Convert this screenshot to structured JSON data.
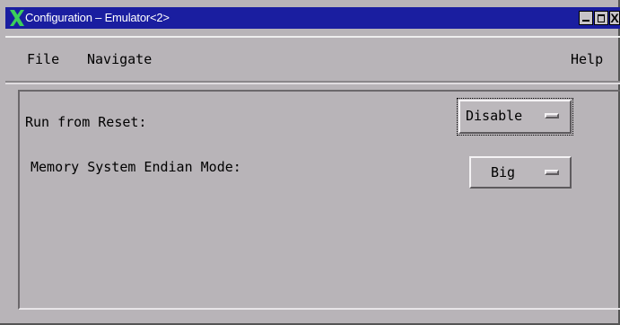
{
  "window": {
    "title": "Configuration – Emulator<2>",
    "close_glyph": "X"
  },
  "menubar": {
    "file": "File",
    "navigate": "Navigate",
    "help": "Help"
  },
  "fields": {
    "run_from_reset": {
      "label": "Run from Reset:",
      "value": "Disable"
    },
    "endian_mode": {
      "label": "Memory System Endian Mode:",
      "value": "Big"
    }
  },
  "colors": {
    "titlebar": "#1a1ea0",
    "logo": "#3ccf5a",
    "background": "#b8b4b8"
  },
  "icons": {
    "app": "x-logo-icon",
    "minimize": "minimize-icon",
    "maximize": "maximize-icon",
    "close": "close-icon",
    "option_indicator": "option-menu-indicator-icon"
  }
}
